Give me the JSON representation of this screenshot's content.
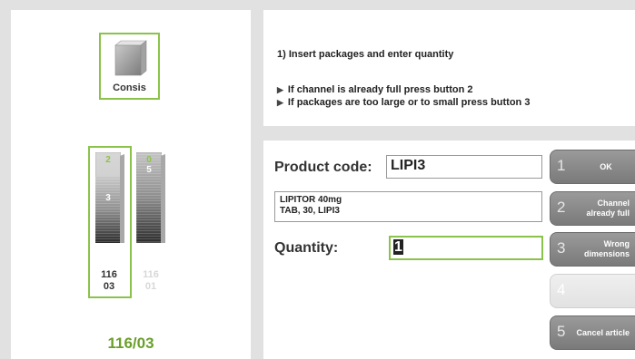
{
  "consis": {
    "label": "Consis"
  },
  "channels": [
    {
      "top_number": "2",
      "fill_number": "3",
      "code_line1": "116",
      "code_line2": "03"
    },
    {
      "top_number": "0",
      "fill_number": "5",
      "code_line1": "116",
      "code_line2": "01"
    }
  ],
  "selected_channel": "116/03",
  "instructions": {
    "title": "1) Insert packages and enter quantity",
    "bullets": [
      "If channel is already full press button 2",
      "If packages are too large or to small press button 3"
    ]
  },
  "form": {
    "product_code_label": "Product code:",
    "product_code_value": "LIPI3",
    "product_desc_line1": "LIPITOR 40mg",
    "product_desc_line2": "TAB, 30, LIPI3",
    "quantity_label": "Quantity:",
    "quantity_value": "1"
  },
  "buttons": [
    {
      "num": "1",
      "label": "OK"
    },
    {
      "num": "2",
      "label_line1": "Channel",
      "label_line2": "already full"
    },
    {
      "num": "3",
      "label_line1": "Wrong",
      "label_line2": "dimensions"
    },
    {
      "num": "4",
      "label": ""
    },
    {
      "num": "5",
      "label": "Cancel article"
    }
  ],
  "colors": {
    "accent_green": "#8bc34a",
    "selected_text_green": "#6a9f2a",
    "button_gray": "#8a8a8a",
    "background": "#e1e1e1"
  },
  "icons": {
    "consis": "cube-icon",
    "bullet": "triangle-right-icon"
  }
}
